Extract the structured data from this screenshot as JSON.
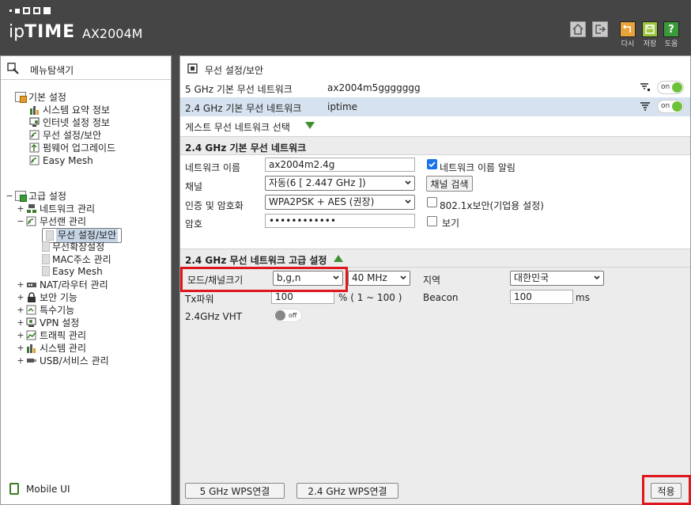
{
  "header": {
    "brand_prefix": "ip",
    "brand_bold": "TIME",
    "model": "AX2004M",
    "buttons": [
      {
        "icon": "home-icon"
      },
      {
        "icon": "logout-icon"
      },
      {
        "icon": "restart-icon",
        "label": "다시"
      },
      {
        "icon": "save-icon",
        "label": "저장"
      },
      {
        "icon": "help-icon",
        "label": "도움"
      }
    ]
  },
  "sidebar": {
    "title": "메뉴탐색기",
    "basic": {
      "label": "기본 설정",
      "items": [
        "시스템 요약 정보",
        "인터넷 설정 정보",
        "무선 설정/보안",
        "펌웨어 업그레이드",
        "Easy Mesh"
      ]
    },
    "advanced": {
      "label": "고급 설정",
      "items": [
        {
          "label": "네트워크 관리",
          "expander": "+"
        },
        {
          "label": "무선랜 관리",
          "expander": "−"
        },
        {
          "label": "NAT/라우터 관리",
          "expander": "+"
        },
        {
          "label": "보안 기능",
          "expander": "+"
        },
        {
          "label": "특수기능",
          "expander": "+"
        },
        {
          "label": "VPN 설정",
          "expander": "+"
        },
        {
          "label": "트래픽 관리",
          "expander": "+"
        },
        {
          "label": "시스템 관리",
          "expander": "+"
        },
        {
          "label": "USB/서비스 관리",
          "expander": "+"
        }
      ],
      "wireless_sub": [
        "무선 설정/보안",
        "무선확장설정",
        "MAC주소 관리",
        "Easy Mesh"
      ]
    },
    "mobile_ui": "Mobile UI"
  },
  "main": {
    "title": "무선 설정/보안",
    "networks": [
      {
        "name": "5 GHz 기본 무선 네트워크",
        "ssid": "ax2004m5ggggggg",
        "toggle": "on"
      },
      {
        "name": "2.4 GHz 기본 무선 네트워크",
        "ssid": "iptime",
        "toggle": "on"
      }
    ],
    "guest_label": "게스트 무선 네트워크 선택",
    "basic_section": {
      "title": "2.4 GHz 기본 무선 네트워크",
      "network_name_label": "네트워크 이름",
      "network_name_value": "ax2004m2.4g",
      "broadcast_label": "네트워크 이름 알림",
      "channel_label": "채널",
      "channel_value": "자동(6 [ 2.447 GHz ])",
      "channel_search": "채널 검색",
      "auth_label": "인증 및 암호화",
      "auth_value": "WPA2PSK + AES (권장)",
      "enterprise_label": "802.1x보안(기업용 설정)",
      "password_label": "암호",
      "password_value": "••••••••••••",
      "show_label": "보기"
    },
    "advanced_section": {
      "title": "2.4 GHz 무선 네트워크 고급 설정",
      "mode_label": "모드/채널크기",
      "mode_value": "b,g,n",
      "width_value": "40 MHz",
      "region_label": "지역",
      "region_value": "대한민국",
      "tx_label": "Tx파워",
      "tx_value": "100",
      "tx_range": "% ( 1 ~ 100 )",
      "beacon_label": "Beacon",
      "beacon_value": "100",
      "beacon_unit": "ms",
      "vht_label": "2.4GHz VHT",
      "vht_toggle": "off"
    },
    "footer": {
      "wps5": "5 GHz WPS연결",
      "wps24": "2.4 GHz WPS연결",
      "apply": "적용"
    }
  },
  "colors": {
    "accent_green": "#6ec13a",
    "highlight": "#e0161e",
    "selected_row": "#d6e2ef"
  }
}
